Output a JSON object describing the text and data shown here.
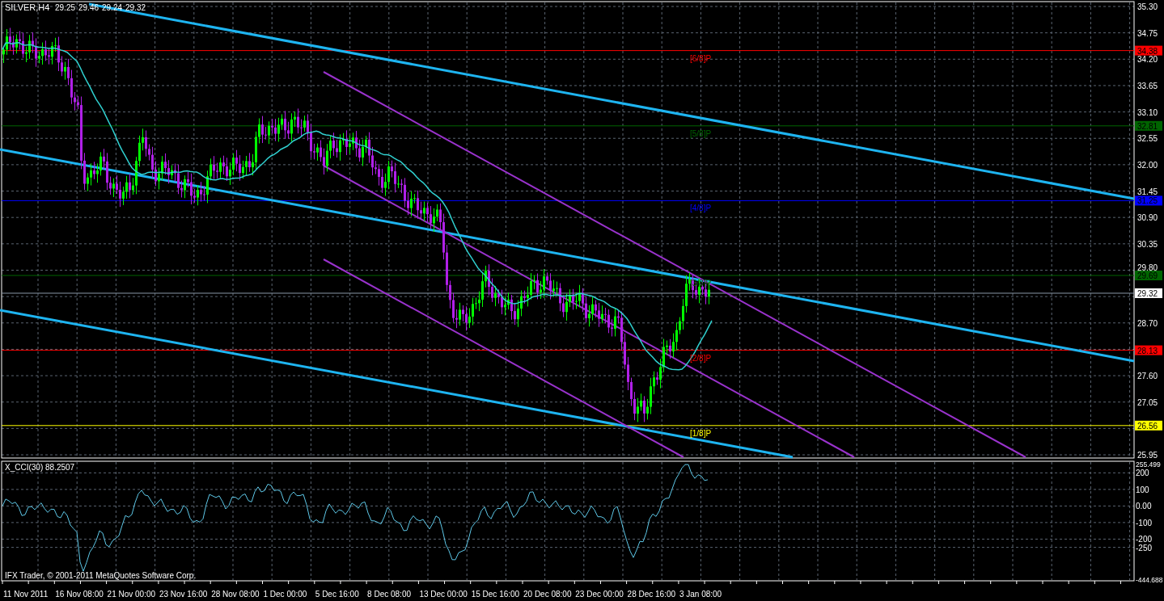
{
  "chart": {
    "symbol": "SILVER,H4",
    "ohlc": [
      "29.25",
      "29.46",
      "29.24",
      "29.32"
    ]
  },
  "price_axis": [
    "35.30",
    "34.75",
    "34.20",
    "33.65",
    "33.10",
    "32.55",
    "32.00",
    "31.45",
    "30.90",
    "30.35",
    "29.80",
    "28.70",
    "27.60",
    "27.05",
    "25.95"
  ],
  "levels": [
    {
      "label": "[6/8]P",
      "tag": "34.38",
      "color": "#ff0000"
    },
    {
      "label": "[5/8]P",
      "tag": "32.81",
      "color": "#006400"
    },
    {
      "label": "[4/8]P",
      "tag": "31.25",
      "color": "#0000ff"
    },
    {
      "label": "[3/8]P",
      "tag": "29.69",
      "color": "#006400"
    },
    {
      "label": "[2/8]P",
      "tag": "28.13",
      "color": "#ff0000"
    },
    {
      "label": "[1/8]P",
      "tag": "26.56",
      "color": "#ffff00"
    }
  ],
  "bid": "29.32",
  "indicator": {
    "title": "X_CCI(30) 88.2507",
    "axis": [
      "255.499",
      "200",
      "100",
      "0.00",
      "-100",
      "-200",
      "-250",
      "-444.688"
    ]
  },
  "time_axis": [
    "11 Nov 2011",
    "16 Nov 08:00",
    "21 Nov 00:00",
    "23 Nov 16:00",
    "28 Nov 08:00",
    "1 Dec 00:00",
    "5 Dec 16:00",
    "8 Dec 08:00",
    "13 Dec 00:00",
    "15 Dec 16:00",
    "20 Dec 08:00",
    "23 Dec 00:00",
    "28 Dec 16:00",
    "3 Jan 08:00"
  ],
  "copyright": "IFX Trader, © 2001-2011 MetaQuotes Software Corp."
}
